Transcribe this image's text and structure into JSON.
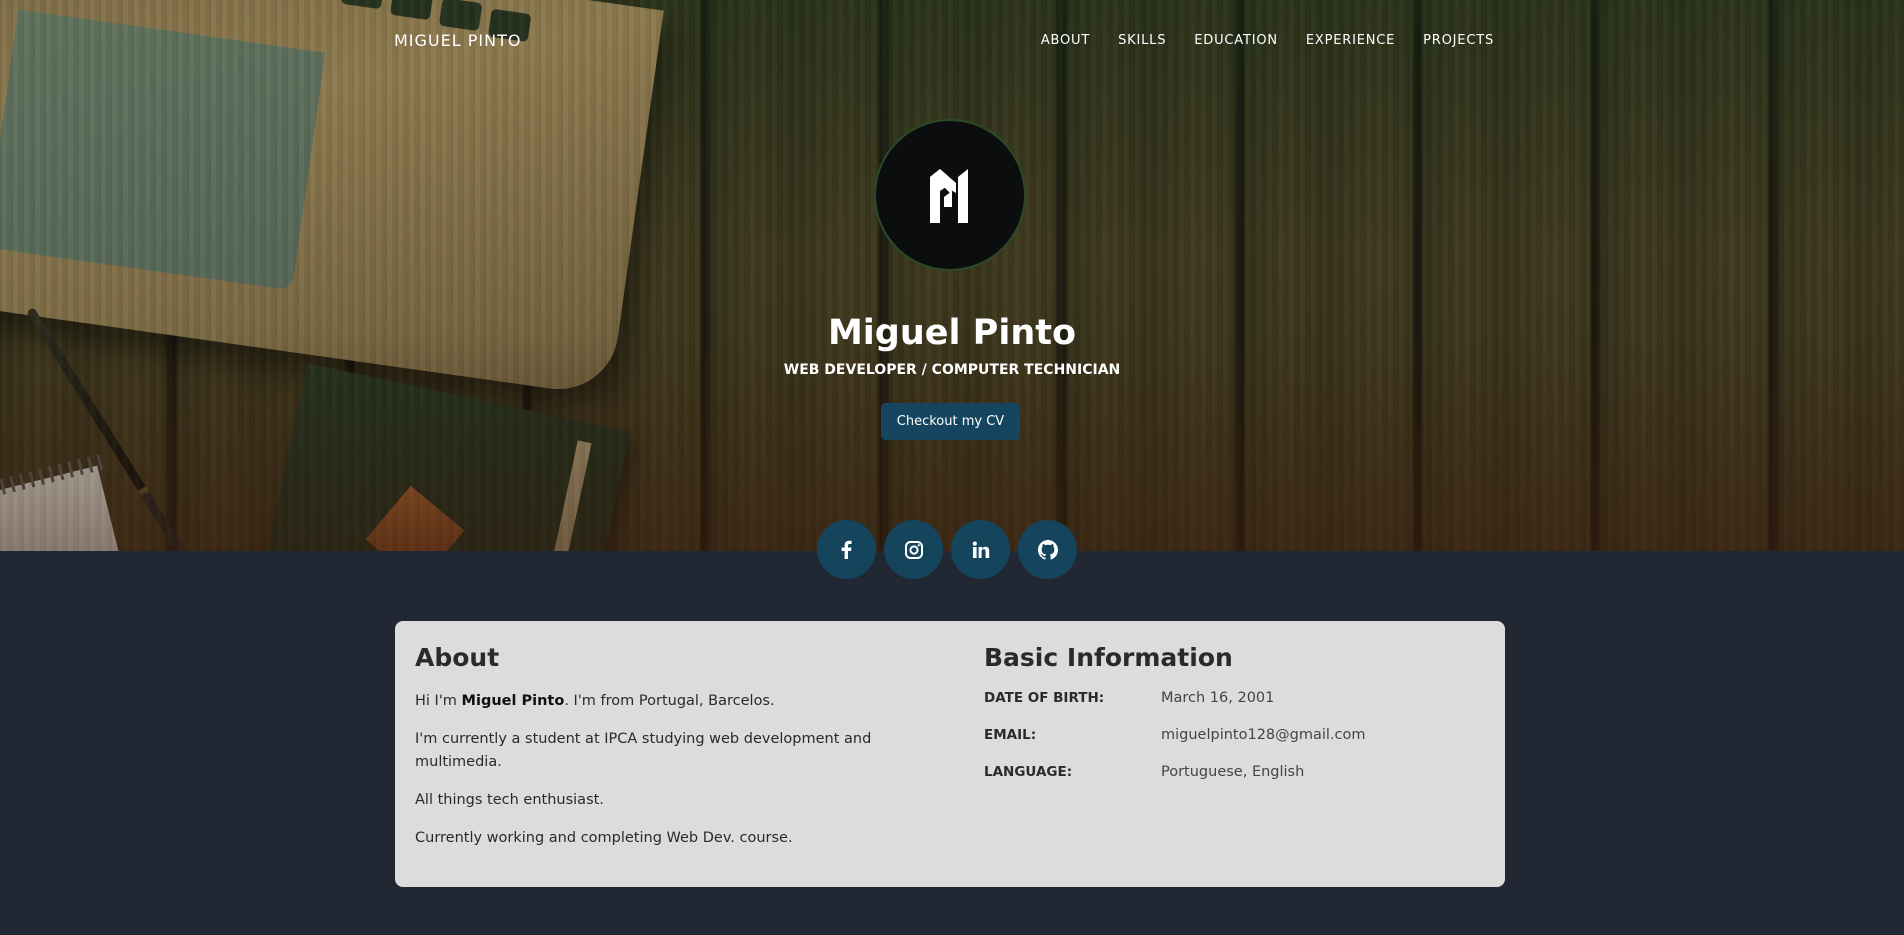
{
  "nav": {
    "brand": "MIGUEL PINTO",
    "items": [
      {
        "label": "ABOUT"
      },
      {
        "label": "SKILLS"
      },
      {
        "label": "EDUCATION"
      },
      {
        "label": "EXPERIENCE"
      },
      {
        "label": "PROJECTS"
      }
    ]
  },
  "hero": {
    "logo_icon": "mp-monogram-logo",
    "name": "Miguel Pinto",
    "role": "WEB DEVELOPER / COMPUTER TECHNICIAN",
    "cv_button": "Checkout my CV"
  },
  "social": [
    {
      "icon": "facebook-icon"
    },
    {
      "icon": "instagram-icon"
    },
    {
      "icon": "linkedin-icon"
    },
    {
      "icon": "github-icon"
    }
  ],
  "about": {
    "title": "About",
    "intro_prefix": "Hi I'm ",
    "intro_name": "Miguel Pinto",
    "intro_suffix": ". I'm from Portugal, Barcelos.",
    "paragraphs": [
      "I'm currently a student at IPCA studying web development and multimedia.",
      "All things tech enthusiast.",
      "Currently working and completing Web Dev. course."
    ]
  },
  "basic_info": {
    "title": "Basic Information",
    "rows": [
      {
        "label": "DATE OF BIRTH:",
        "value": "March 16, 2001"
      },
      {
        "label": "EMAIL:",
        "value": "miguelpinto128@gmail.com"
      },
      {
        "label": "LANGUAGE:",
        "value": "Portuguese, English"
      }
    ]
  },
  "colors": {
    "page_background": "#212733",
    "accent_button": "#16465f",
    "card_background": "#dcdcdc"
  }
}
